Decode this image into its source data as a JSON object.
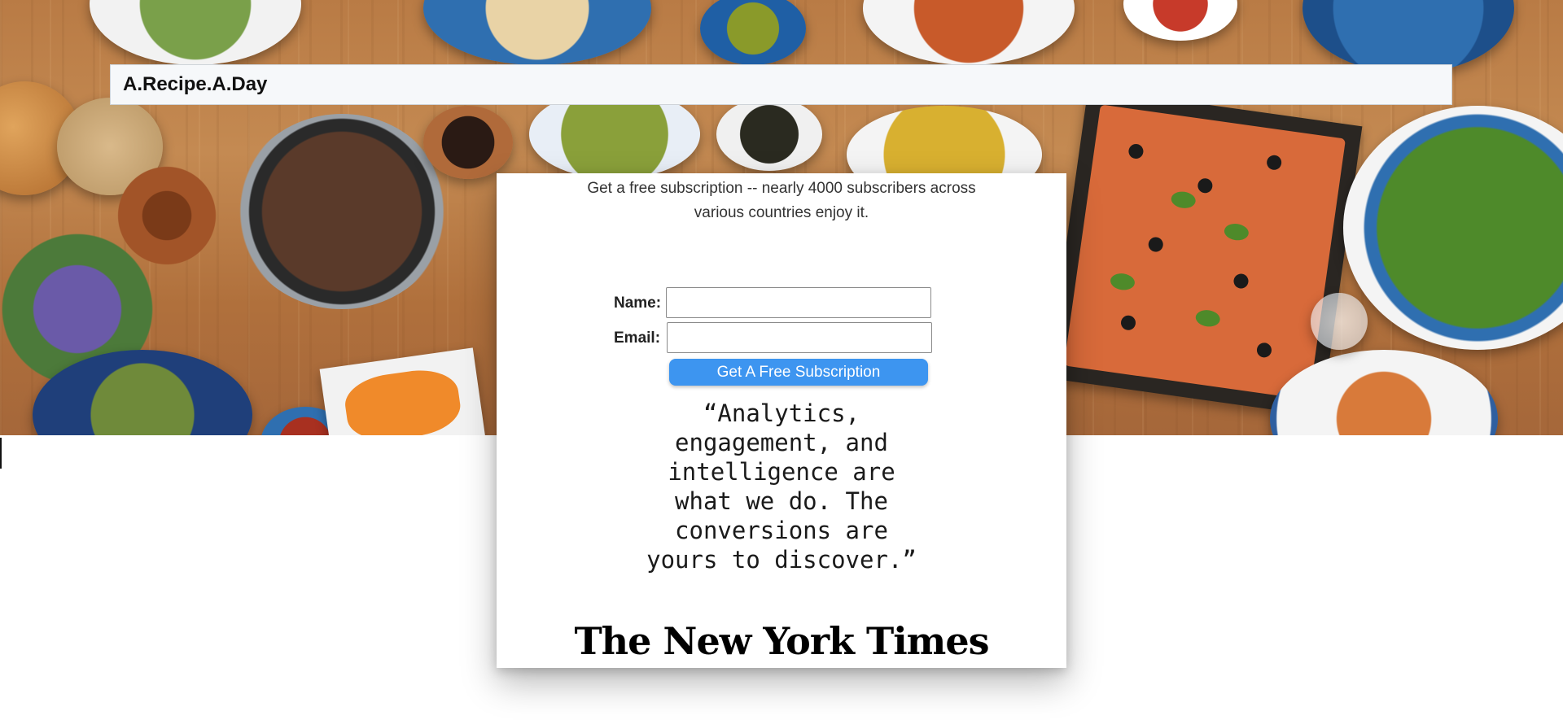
{
  "header": {
    "brand": "A.Recipe.A.Day"
  },
  "signup": {
    "intro_line_1": "Get a free subscription -- nearly 4000 subscribers across",
    "intro_line_2": "various countries enjoy it.",
    "name_label": "Name:",
    "name_value": "",
    "email_label": "Email:",
    "email_value": "",
    "button_label": "Get A Free Subscription"
  },
  "quote": {
    "lines": [
      "“Analytics,",
      "engagement, and",
      "intelligence are",
      "what we do. The",
      "conversions are",
      "yours to discover.”"
    ]
  },
  "press": {
    "logo_text": "The New York Times"
  },
  "colors": {
    "button": "#3d95f0",
    "header_bg": "#f6f8fa"
  }
}
